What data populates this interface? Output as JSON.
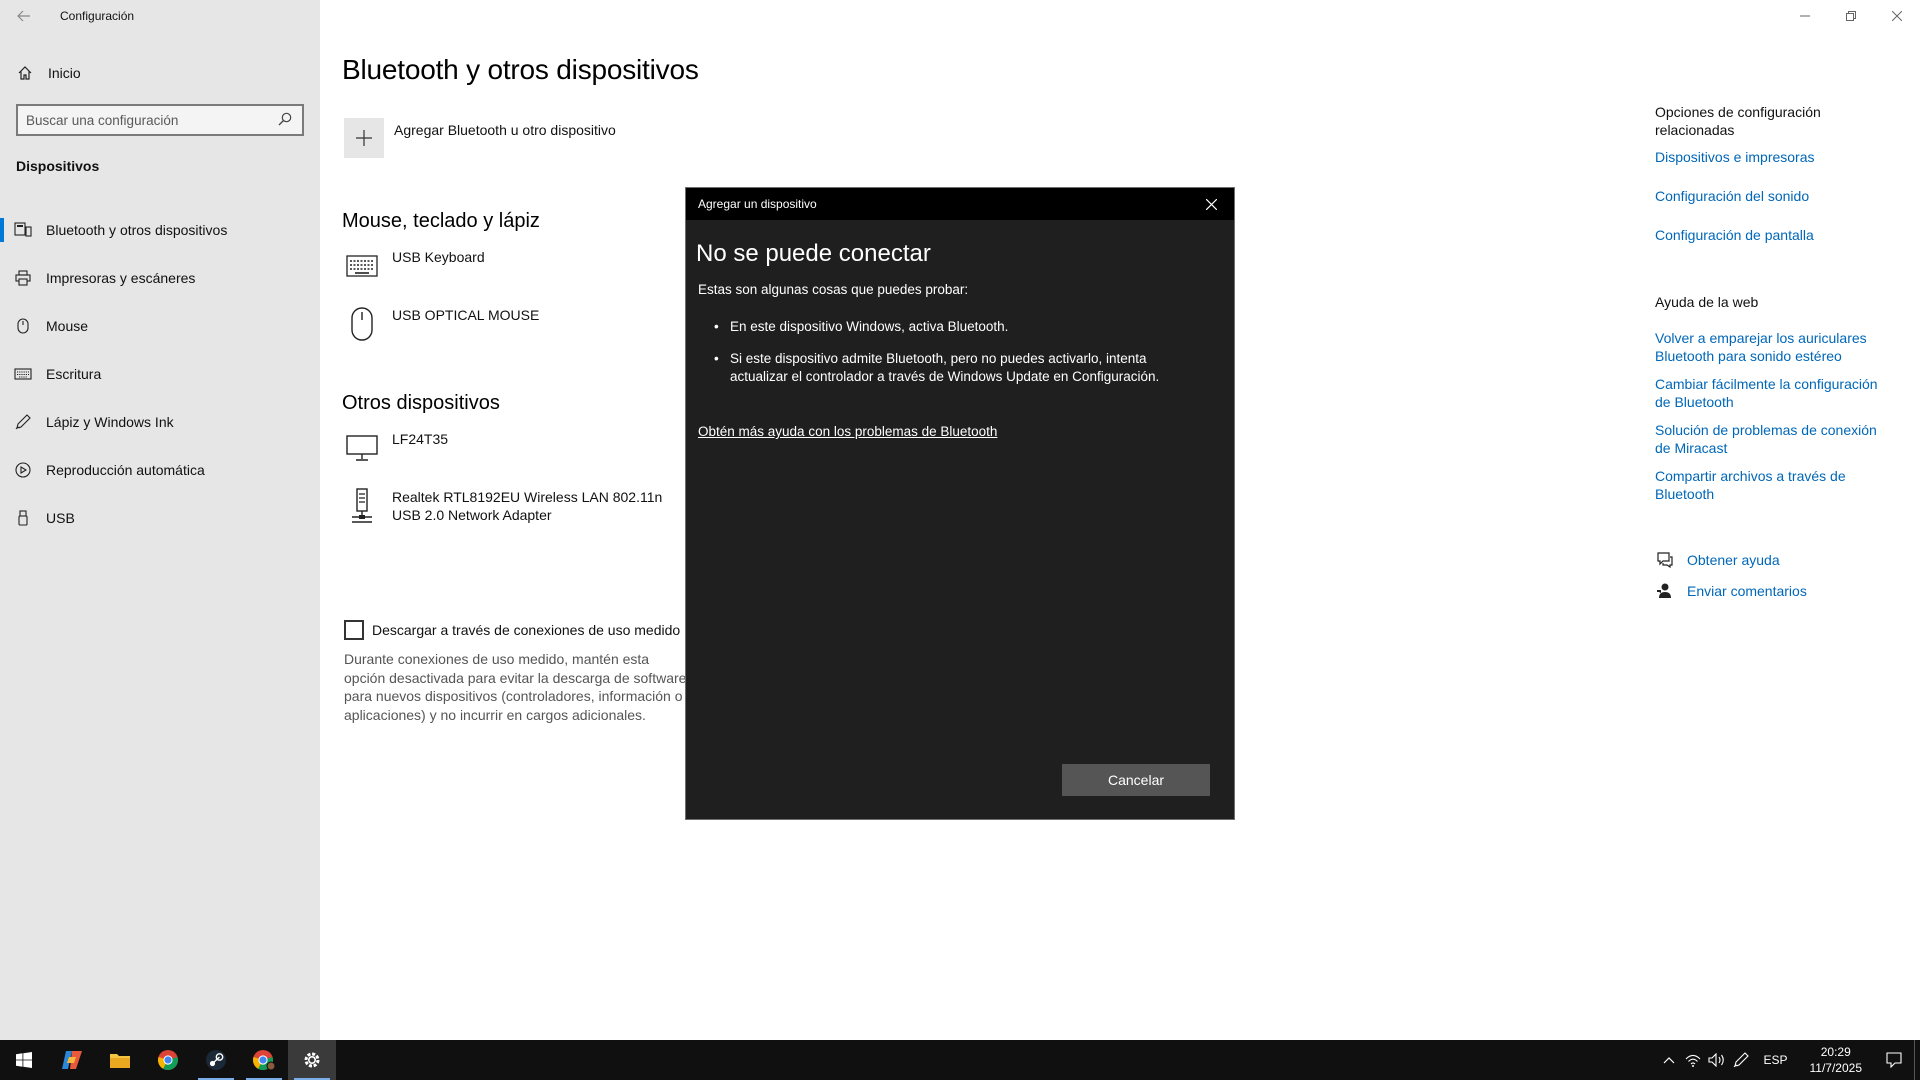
{
  "window": {
    "title": "Configuración"
  },
  "sidebar": {
    "home_label": "Inicio",
    "search_placeholder": "Buscar una configuración",
    "group_label": "Dispositivos",
    "items": [
      {
        "label": "Bluetooth y otros dispositivos",
        "icon": "bluetooth-devices-icon",
        "active": true
      },
      {
        "label": "Impresoras y escáneres",
        "icon": "printer-icon",
        "active": false
      },
      {
        "label": "Mouse",
        "icon": "mouse-icon",
        "active": false
      },
      {
        "label": "Escritura",
        "icon": "keyboard-icon",
        "active": false
      },
      {
        "label": "Lápiz y Windows Ink",
        "icon": "pen-icon",
        "active": false
      },
      {
        "label": "Reproducción automática",
        "icon": "autoplay-icon",
        "active": false
      },
      {
        "label": "USB",
        "icon": "usb-icon",
        "active": false
      }
    ]
  },
  "main": {
    "title": "Bluetooth y otros dispositivos",
    "add_device_label": "Agregar Bluetooth u otro dispositivo",
    "section_mouse_keyboard": "Mouse, teclado y lápiz",
    "devices_mouse_keyboard": [
      {
        "name": "USB Keyboard",
        "icon": "keyboard-icon"
      },
      {
        "name": "USB OPTICAL MOUSE",
        "icon": "mouse-icon"
      }
    ],
    "section_other": "Otros dispositivos",
    "devices_other": [
      {
        "name": "LF24T35",
        "icon": "monitor-icon"
      },
      {
        "name": "Realtek RTL8192EU Wireless LAN 802.11n USB 2.0 Network Adapter",
        "icon": "network-adapter-icon"
      }
    ],
    "metered_label": "Descargar a través de conexiones de uso medido",
    "metered_checked": false,
    "metered_description": "Durante conexiones de uso medido, mantén esta opción desactivada para evitar la descarga de software para nuevos dispositivos (controladores, información o aplicaciones) y no incurrir en cargos adicionales."
  },
  "related": {
    "heading": "Opciones de configuración relacionadas",
    "links": [
      "Dispositivos e impresoras",
      "Configuración del sonido",
      "Configuración de pantalla"
    ],
    "web_help_heading": "Ayuda de la web",
    "web_links": [
      "Volver a emparejar los auriculares Bluetooth para sonido estéreo",
      "Cambiar fácilmente la configuración de Bluetooth",
      "Solución de problemas de conexión de Miracast",
      "Compartir archivos a través de Bluetooth"
    ],
    "get_help": "Obtener ayuda",
    "send_feedback": "Enviar comentarios"
  },
  "dialog": {
    "title": "Agregar un dispositivo",
    "heading": "No se puede conectar",
    "intro": "Estas son algunas cosas que puedes probar:",
    "bullets": [
      "En este dispositivo Windows, activa Bluetooth.",
      "Si este dispositivo admite Bluetooth, pero no puedes activarlo, intenta actualizar el controlador a través de Windows Update en Configuración."
    ],
    "help_link": "Obtén más ayuda con los problemas de Bluetooth",
    "cancel_label": "Cancelar"
  },
  "taskbar": {
    "apps": [
      "start-icon",
      "copilot-icon",
      "file-explorer-icon",
      "chrome-icon",
      "steam-icon",
      "chrome-profile-icon",
      "settings-icon"
    ],
    "language": "ESP",
    "time": "20:29",
    "date": "11/7/2025"
  },
  "colors": {
    "accent": "#0078d7",
    "link": "#0067b8",
    "dialog_bg": "#1f1f1f",
    "taskbar_bg": "#101010"
  }
}
